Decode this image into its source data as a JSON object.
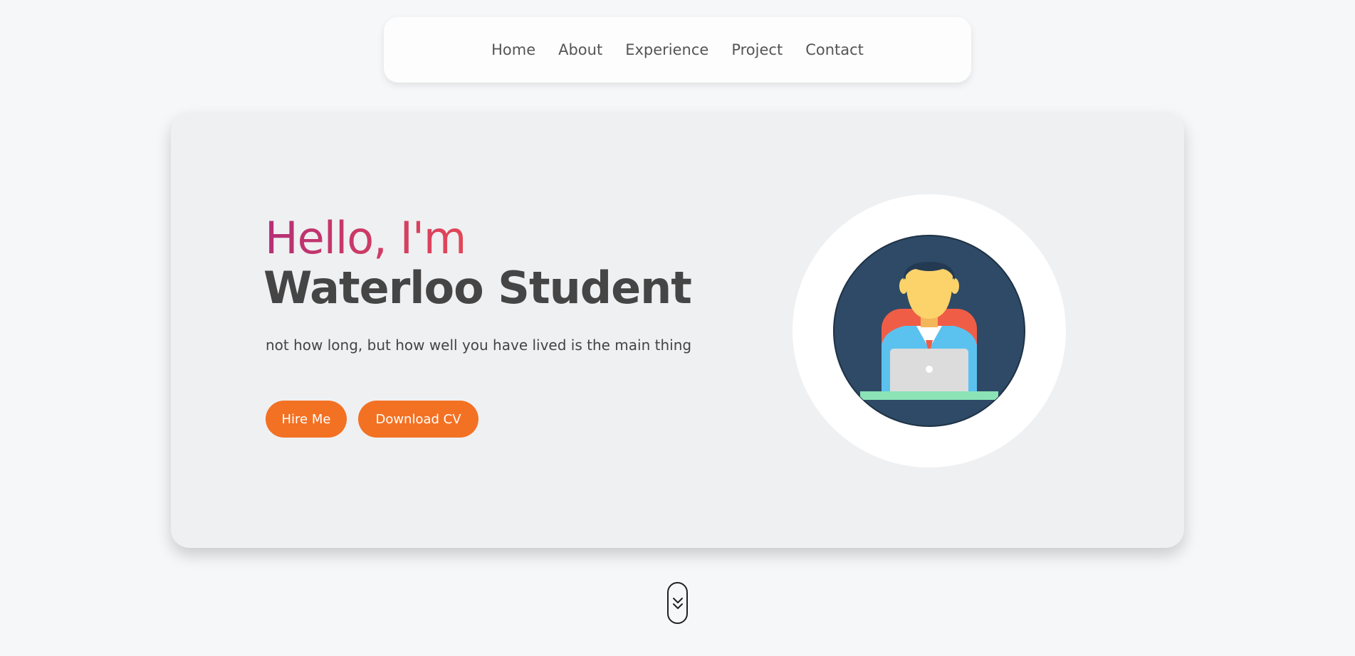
{
  "nav": {
    "items": [
      {
        "label": "Home"
      },
      {
        "label": "About"
      },
      {
        "label": "Experience"
      },
      {
        "label": "Project"
      },
      {
        "label": "Contact"
      }
    ]
  },
  "hero": {
    "greeting": "Hello, I'm",
    "name": "Waterloo Student",
    "tagline": "not how long, but how well you have lived is the main thing",
    "buttons": {
      "hire_label": "Hire Me",
      "cv_label": "Download CV"
    },
    "avatar": {
      "icon": "developer-avatar-icon"
    }
  },
  "scroll": {
    "icon": "chevrons-down-icon"
  },
  "colors": {
    "accent": "#f37123",
    "greeting_gradient_start": "#b52f76",
    "greeting_gradient_end": "#e24756",
    "avatar_bg": "#2e4a66"
  }
}
